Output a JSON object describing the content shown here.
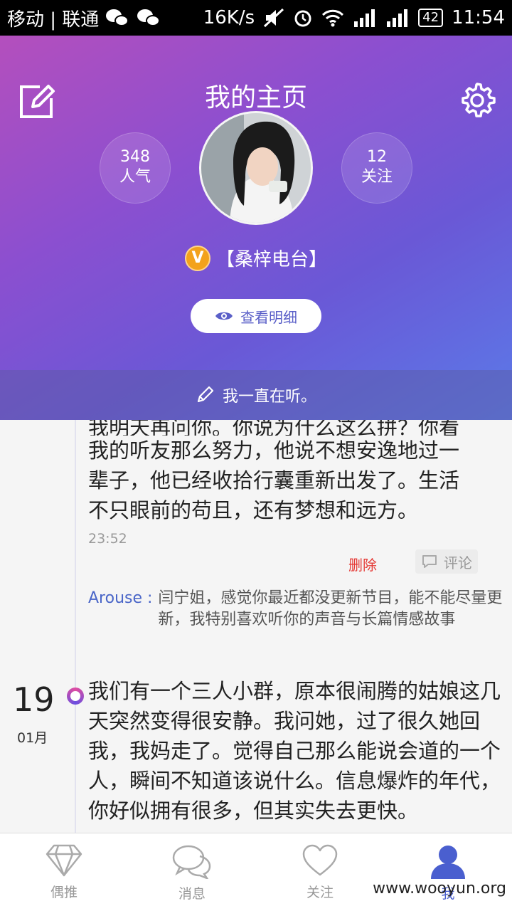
{
  "status_bar": {
    "carrier": "移动 | 联通",
    "speed": "16K/s",
    "battery": "42",
    "time": "11:54"
  },
  "header": {
    "title": "我的主页",
    "stats": {
      "popularity_value": "348",
      "popularity_label": "人气",
      "following_value": "12",
      "following_label": "关注"
    },
    "vip_label": "V",
    "username": "【桑梓电台】",
    "details_button": "查看明细",
    "signature": "我一直在听。"
  },
  "feed": {
    "post1": {
      "line0": "我明天再问你。你说为什么这么拼？你看",
      "line1": "我的听友那么努力，他说不想安逸地过一",
      "line2": "辈子，他已经收拾行囊重新出发了。生活",
      "line3": "不只眼前的苟且，还有梦想和远方。",
      "time": "23:52",
      "delete_label": "删除",
      "comment_label": "评论",
      "comment_author": "Arouse :",
      "comment_text": "闫宁姐，感觉你最近都没更新节目，能不能尽量更新，我特别喜欢听你的声音与长篇情感故事"
    },
    "post2": {
      "day": "19",
      "month": "01月",
      "text": "我们有一个三人小群，原本很闹腾的姑娘这几天突然变得很安静。我问她，过了很久她回我，我妈走了。觉得自己那么能说会道的一个人，瞬间不知道该说什么。信息爆炸的年代，你好似拥有很多，但其实失去更快。"
    }
  },
  "bottom_nav": {
    "items": [
      {
        "label": "偶推",
        "icon": "diamond-icon"
      },
      {
        "label": "消息",
        "icon": "chat-bubbles-icon"
      },
      {
        "label": "关注",
        "icon": "heart-icon"
      },
      {
        "label": "我",
        "icon": "user-icon"
      }
    ],
    "active_index": 3
  },
  "watermark": "www.wooyun.org"
}
